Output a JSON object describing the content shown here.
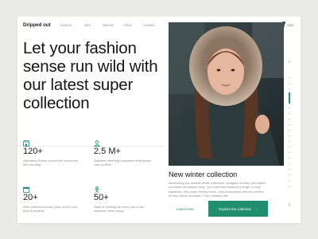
{
  "nav": {
    "logo": "Dripped out",
    "links": [
      "Explore",
      "Men",
      "Women",
      "Shop",
      "Contact"
    ],
    "cart_label": "Cart"
  },
  "hero": {
    "title": "Let your fashion sense run wild with our latest super collection"
  },
  "stats": [
    {
      "icon": "store-icon",
      "value": "120+",
      "desc": "Operating Stores around the world and still counting"
    },
    {
      "icon": "user-icon",
      "value": "2.5 M+",
      "desc": "Satisfied returning customers with active user profiles"
    },
    {
      "icon": "calendar-icon",
      "value": "20+",
      "desc": "New collections every year to find your best fit anytime"
    },
    {
      "icon": "person-icon",
      "value": "50+",
      "desc": "Style of clothing as every one of our customer feels happy"
    }
  ],
  "collection": {
    "title": "New winter collection",
    "description": "Introducing our newest winter collection, designed to keep you stylish and warm all season long. Our collection features a range of cozy sweaters, chic coats, trendy boots, and accessories that are perfect for any winter occasion. From holiday part...",
    "learn_more": "Learn more",
    "explore": "Explore the collection",
    "explore_arrow": "→"
  },
  "slider": {
    "up_arrow": "↑",
    "down_arrow": "↓",
    "active_index": 3,
    "count": 16
  },
  "colors": {
    "accent": "#1f8f6d",
    "background": "#e9eae7"
  }
}
